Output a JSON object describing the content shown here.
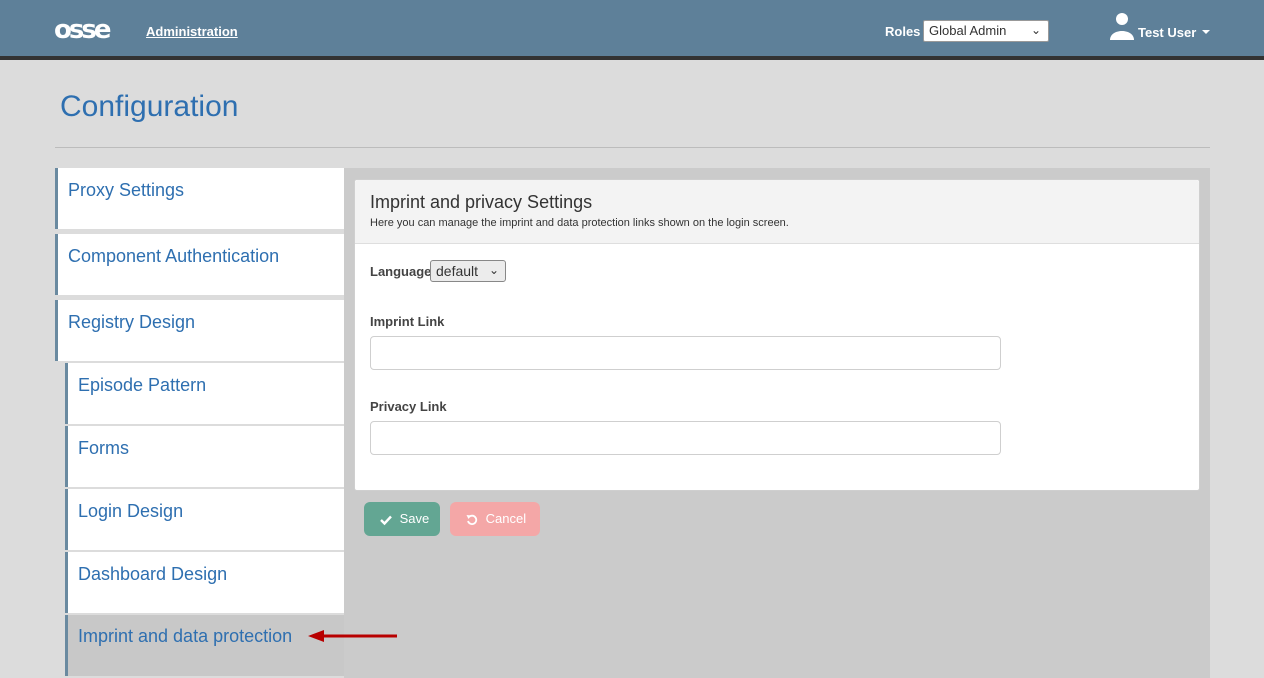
{
  "header": {
    "logo_text": "osse",
    "admin_link": "Administration",
    "roles_label": "Roles",
    "roles_selected": "Global Admin",
    "user_name": "Test User"
  },
  "page": {
    "title": "Configuration"
  },
  "sidebar": {
    "items": [
      {
        "label": "Proxy Settings"
      },
      {
        "label": "Component Authentication"
      },
      {
        "label": "Registry Design"
      },
      {
        "label": "Episode Pattern"
      },
      {
        "label": "Forms"
      },
      {
        "label": "Login Design"
      },
      {
        "label": "Dashboard Design"
      },
      {
        "label": "Imprint and data protection",
        "active": true
      }
    ]
  },
  "panel": {
    "title": "Imprint and privacy Settings",
    "subtitle": "Here you can manage the imprint and data protection links shown on the login screen.",
    "language_label": "Language",
    "language_selected": "default",
    "imprint_label": "Imprint Link",
    "imprint_value": "",
    "privacy_label": "Privacy Link",
    "privacy_value": ""
  },
  "buttons": {
    "save_label": "Save",
    "cancel_label": "Cancel"
  },
  "colors": {
    "header": "#5e8099",
    "link": "#2e6fb0",
    "save": "#63a693",
    "cancel": "#f4a7a7",
    "annotation_arrow": "#b80000"
  }
}
